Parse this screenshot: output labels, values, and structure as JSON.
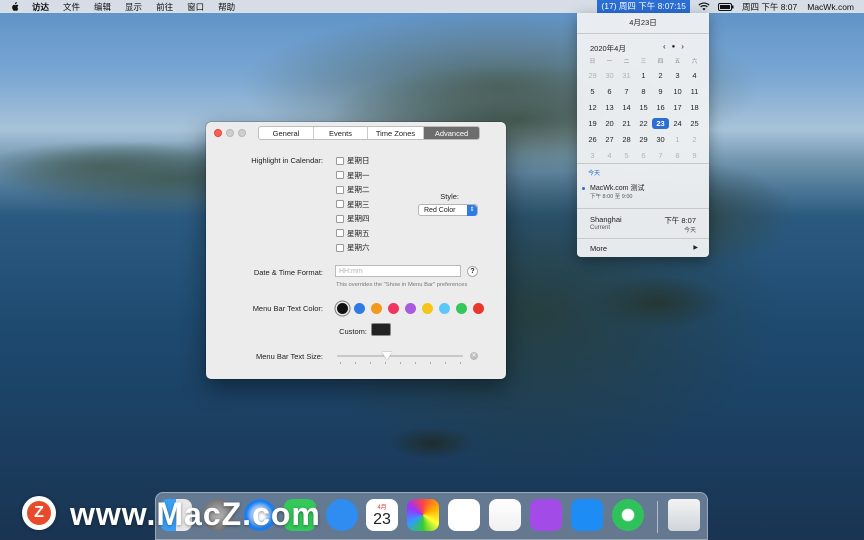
{
  "menubar": {
    "items": [
      "访达",
      "文件",
      "编辑",
      "显示",
      "前往",
      "窗口",
      "帮助"
    ],
    "clock_pill": "(17) 周四 下午 8:07:15",
    "datetime": "周四 下午 8:07",
    "site": "MacWk.com",
    "icons": [
      "apple-icon",
      "wifi-icon",
      "battery-icon"
    ]
  },
  "prefs": {
    "tabs": [
      "General",
      "Events",
      "Time Zones",
      "Advanced"
    ],
    "active_tab": "Advanced",
    "highlight_label": "Highlight in Calendar:",
    "weekdays": [
      "星期日",
      "星期一",
      "星期二",
      "星期三",
      "星期四",
      "星期五",
      "星期六"
    ],
    "style_label": "Style:",
    "style_value": "Red Color",
    "dt_format_label": "Date & Time Format:",
    "dt_format_placeholder": "HH:mm",
    "dt_format_hint": "This overrides the \"Show in Menu Bar\" preferences",
    "help": "?",
    "text_color_label": "Menu Bar Text Color:",
    "swatches": [
      "#111111",
      "#2f7be6",
      "#f39a1e",
      "#f0355f",
      "#a95be0",
      "#f5c518",
      "#5ac8fa",
      "#34c759",
      "#e8382e"
    ],
    "custom_label": "Custom:",
    "custom_color": "#222222",
    "text_size_label": "Menu Bar Text Size:",
    "text_size_level": 0.4
  },
  "popover": {
    "date_header": "4月23日",
    "month_title": "2020年4月",
    "nav_prev": "‹",
    "nav_dot": "●",
    "nav_next": "›",
    "weekday_heads": [
      "日",
      "一",
      "二",
      "三",
      "四",
      "五",
      "六"
    ],
    "weeks": [
      [
        "29",
        "30",
        "31",
        "1",
        "2",
        "3",
        "4"
      ],
      [
        "5",
        "6",
        "7",
        "8",
        "9",
        "10",
        "11"
      ],
      [
        "12",
        "13",
        "14",
        "15",
        "16",
        "17",
        "18"
      ],
      [
        "19",
        "20",
        "21",
        "22",
        "23",
        "24",
        "25"
      ],
      [
        "26",
        "27",
        "28",
        "29",
        "30",
        "1",
        "2"
      ],
      [
        "3",
        "4",
        "5",
        "6",
        "7",
        "8",
        "9"
      ]
    ],
    "section_today": "今天",
    "event_title": "MacWk.com 测试",
    "event_time": "下午 8:00 至 9:00",
    "tz_city": "Shanghai",
    "tz_sub": "Current",
    "tz_time": "下午 8:07",
    "tz_day": "今天",
    "more": "More",
    "more_arrow": "▶"
  },
  "dock": {
    "calendar_month": "4月",
    "calendar_day": "23"
  },
  "watermark": {
    "badge": "Z",
    "text": "www.MacZ.com"
  }
}
